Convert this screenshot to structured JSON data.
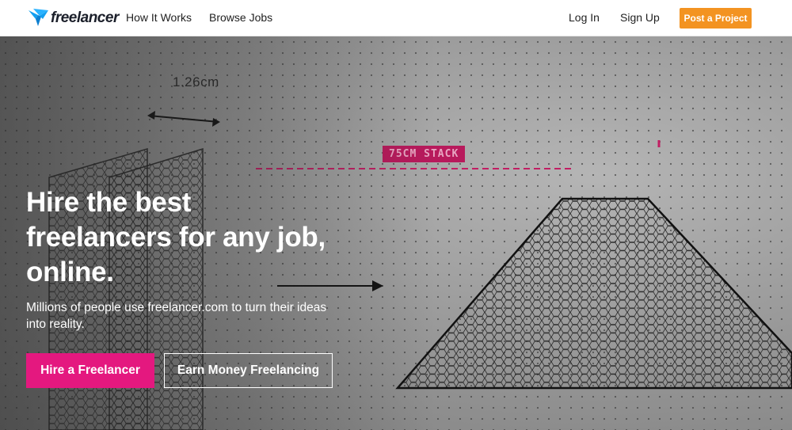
{
  "header": {
    "logo_text": "freelancer",
    "nav_links": [
      "How It Works",
      "Browse Jobs"
    ],
    "login_label": "Log In",
    "signup_label": "Sign Up",
    "post_project_label": "Post a Project"
  },
  "hero": {
    "headline_lines": [
      "Hire the best",
      "freelancers for any job,",
      "online."
    ],
    "subtext": "Millions of people use freelancer.com to turn their ideas into reality.",
    "hire_button_label": "Hire a Freelancer",
    "earn_button_label": "Earn Money Freelancing",
    "dimension_label": "1.26cm",
    "stack_label": "75CM STACK"
  },
  "colors": {
    "brand_blue": "#139ff0",
    "accent_orange": "#f39321",
    "accent_pink": "#e4187f"
  },
  "icons": [
    "freelancer-bird-logo-icon"
  ]
}
